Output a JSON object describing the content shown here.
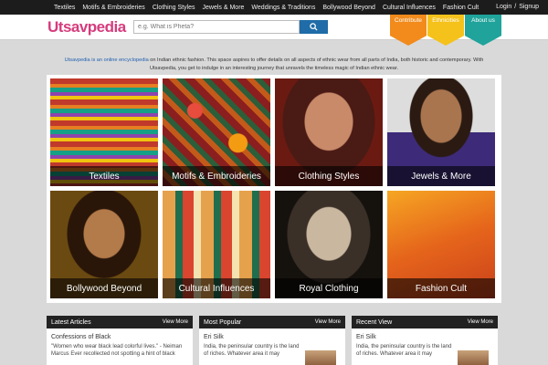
{
  "topnav": {
    "items": [
      "Textiles",
      "Motifs & Embroideries",
      "Clothing Styles",
      "Jewels & More",
      "Weddings & Traditions",
      "Bollywood Beyond",
      "Cultural Influences",
      "Fashion Cult"
    ],
    "login": "Login",
    "separator": "/",
    "signup": "Signup"
  },
  "header": {
    "logo": "Utsavpedia",
    "search_placeholder": "e.g. What is Pheta?",
    "flags": [
      "Contribute",
      "Ethnicities",
      "About us"
    ]
  },
  "intro": {
    "link_text": "Utsavpedia is an online encyclopedia",
    "text": " on Indian ethnic fashion. This space aspires to offer details on all aspects of ethnic wear from all parts of India, both historic and contemporary. With Utsavpedia, you get to indulge in an interesting journey that unravels the timeless magic of Indian ethnic wear."
  },
  "tiles": [
    "Textiles",
    "Motifs & Embroideries",
    "Clothing Styles",
    "Jewels & More",
    "Bollywood Beyond",
    "Cultural Influences",
    "Royal Clothing",
    "Fashion Cult"
  ],
  "panels": [
    {
      "title": "Latest Articles",
      "more": "View More",
      "item_title": "Confessions of Black",
      "snippet": "\"Women who wear black lead colorful lives.\" - Neiman Marcus Ever recollected not spotting a hint of black"
    },
    {
      "title": "Most Popular",
      "more": "View More",
      "item_title": "Eri Silk",
      "snippet": "India, the peninsular country is the land of riches. Whatever area it may"
    },
    {
      "title": "Recent View",
      "more": "View More",
      "item_title": "Eri Silk",
      "snippet": "India, the peninsular country is the land of riches. Whatever area it may"
    }
  ],
  "colors": {
    "logo": "#d63b7d",
    "search_button": "#1f6ca8",
    "flag_contribute": "#f28b1c",
    "flag_ethnicities": "#f5c21b",
    "flag_about": "#1fa39b"
  }
}
